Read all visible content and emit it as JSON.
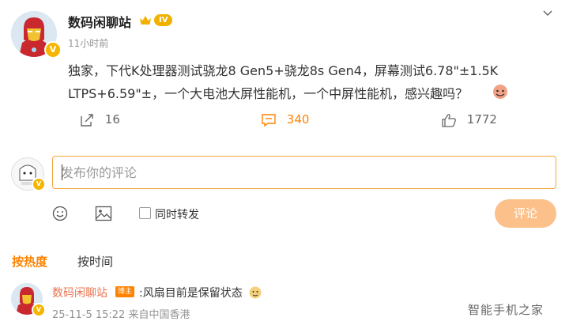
{
  "post": {
    "author": "数码闲聊站",
    "level_badge": "IV",
    "verified_badge": "V",
    "time": "11小时前",
    "content": "独家，下代K处理器测试骁龙8 Gen5+骁龙8s Gen4，屏幕测试6.78\"±1.5K LTPS+6.59\"±，一个大电池大屏性能机，一个中屏性能机，感兴趣吗？",
    "reposts": "16",
    "comments": "340",
    "likes": "1772"
  },
  "composer": {
    "placeholder": "发布你的评论",
    "also_repost_label": "同时转发",
    "submit_label": "评论",
    "verified_badge": "V"
  },
  "sort": {
    "hot_label": "按热度",
    "time_label": "按时间"
  },
  "comment": {
    "author": "数码闲聊站",
    "author_tag": "博主",
    "text": ":风扇目前是保留状态",
    "meta": "25-11-5 15:22 来自中国香港",
    "verified_badge": "V"
  },
  "watermark": "智能手机之家",
  "colors": {
    "accent": "#ff8200",
    "input_border": "#f4a43c",
    "submit_disabled": "#fcc08a",
    "action_active": "#ff8200",
    "username": "#eb7350"
  }
}
